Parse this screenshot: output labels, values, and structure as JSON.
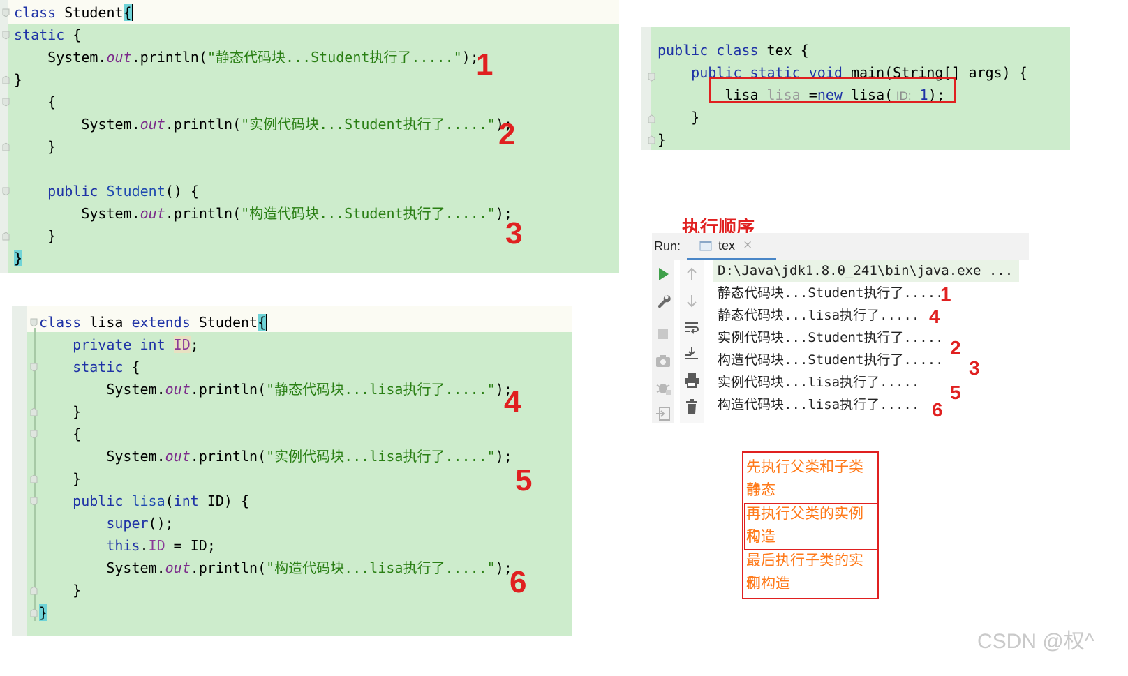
{
  "student_code": {
    "l1_kw": "class",
    "l1_name": " Student",
    "l1_brace": "{",
    "l2_kw": "static",
    "l2_rest": " {",
    "l3_pre": "    System.",
    "l3_out": "out",
    "l3_mid": ".println(",
    "l3_str": "\"静态代码块...Student执行了.....\"",
    "l3_end": ");",
    "l4": "}",
    "l5": "    {",
    "l6_pre": "        System.",
    "l6_out": "out",
    "l6_mid": ".println(",
    "l6_str": "\"实例代码块...Student执行了.....\"",
    "l6_end": ");",
    "l7": "    }",
    "l9_kw": "    public",
    "l9_type": " Student",
    "l9_rest": "() {",
    "l10_pre": "        System.",
    "l10_out": "out",
    "l10_mid": ".println(",
    "l10_str": "\"构造代码块...Student执行了.....\"",
    "l10_end": ");",
    "l11": "    }",
    "l12": "}"
  },
  "tex_code": {
    "l1_kw": "public class",
    "l1_rest": " tex {",
    "l2_kw": "    public static void",
    "l2_rest": " main(String[] args) {",
    "l3_type": "lisa",
    "l3_var": " lisa",
    "l3_eq": " =",
    "l3_new": "new",
    "l3_call": " lisa(",
    "l3_hint": " ID:",
    "l3_num": " 1",
    "l3_end": ");",
    "l4": "    }",
    "l5": "}"
  },
  "lisa_code": {
    "l1_kw": "class",
    "l1_name": " lisa ",
    "l1_ext": "extends",
    "l1_sup": " Student",
    "l1_brace": "{",
    "l2_kw": "    private int",
    "l2_field": "ID",
    "l2_end": ";",
    "l3_kw": "    static",
    "l3_rest": " {",
    "l4_pre": "        System.",
    "l4_out": "out",
    "l4_mid": ".println(",
    "l4_str": "\"静态代码块...lisa执行了.....\"",
    "l4_end": ");",
    "l5": "    }",
    "l6": "    {",
    "l7_pre": "        System.",
    "l7_out": "out",
    "l7_mid": ".println(",
    "l7_str": "\"实例代码块...lisa执行了.....\"",
    "l7_end": ");",
    "l8": "    }",
    "l9_kw": "    public",
    "l9_type": " lisa",
    "l9_p": "(",
    "l9_int": "int",
    "l9_rest": " ID) {",
    "l10_kw": "        super",
    "l10_rest": "();",
    "l11_kw": "        this",
    "l11_dot": ".",
    "l11_field": "ID",
    "l11_rest": " = ID;",
    "l12_pre": "        System.",
    "l12_out": "out",
    "l12_mid": ".println(",
    "l12_str": "\"构造代码块...lisa执行了.....\"",
    "l12_end": ");",
    "l13": "    }",
    "l14": "}"
  },
  "step_numbers": [
    "1",
    "2",
    "3",
    "4",
    "5",
    "6"
  ],
  "run_panel": {
    "title": "执行顺序",
    "run_label": "Run:",
    "tab_label": "tex",
    "tab_close": "×",
    "cmd_line": "D:\\Java\\jdk1.8.0_241\\bin\\java.exe ...",
    "output": [
      {
        "text": "静态代码块...Student执行了.....",
        "num": "1"
      },
      {
        "text": "静态代码块...lisa执行了.....",
        "num": "4"
      },
      {
        "text": "实例代码块...Student执行了.....",
        "num": "2"
      },
      {
        "text": "构造代码块...Student执行了.....",
        "num": "3"
      },
      {
        "text": "实例代码块...lisa执行了.....",
        "num": "5"
      },
      {
        "text": "构造代码块...lisa执行了.....",
        "num": "6"
      }
    ],
    "icons": [
      "run-icon",
      "wrench-icon",
      "stop-icon",
      "camera-icon",
      "bug-icon",
      "exit-icon",
      "up-arrow-icon",
      "down-arrow-icon",
      "wrap-icon",
      "scroll-end-icon",
      "print-icon",
      "trash-icon"
    ]
  },
  "notes": {
    "n1a": "先执行父类和子类的",
    "n1b": "静态",
    "n2a": "再执行父类的实例和",
    "n2b": "构造",
    "n3a": "最后执行子类的实例",
    "n3b": "和构造"
  },
  "watermark": "CSDN @权^",
  "colors": {
    "panel_bg": "#cdeccc",
    "red": "#e02020",
    "keyword": "#1f33a6",
    "string": "#2a7f14",
    "note": "#ff7a1a"
  }
}
